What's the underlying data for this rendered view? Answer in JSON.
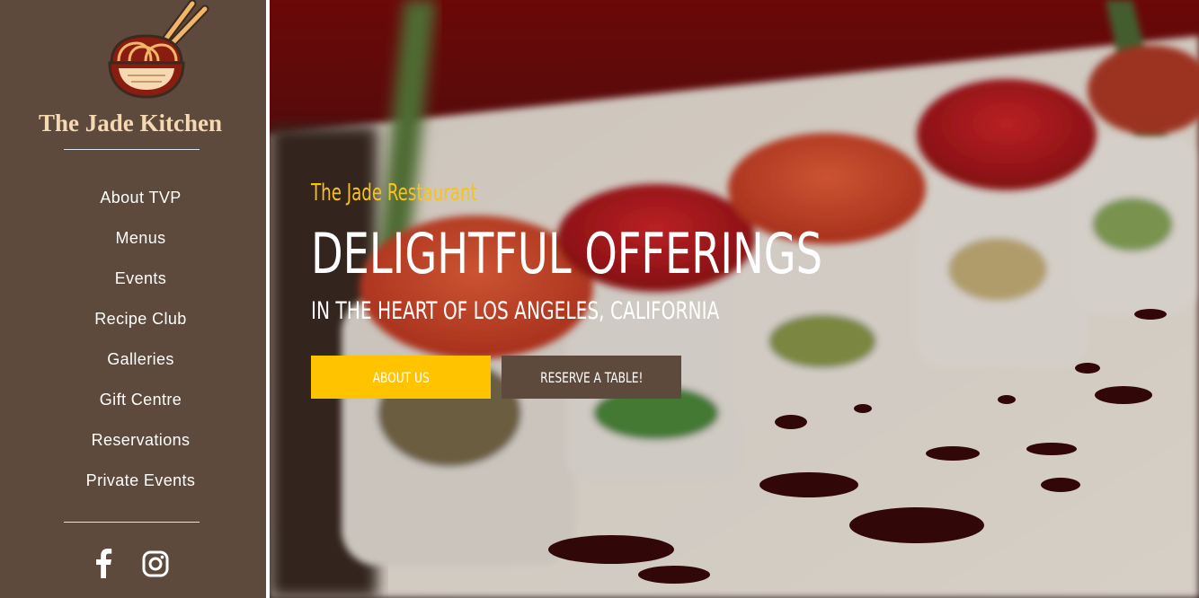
{
  "brand": {
    "name": "The Jade Kitchen",
    "logo_icon": "noodle-bowl-chopsticks-icon"
  },
  "nav": {
    "items": [
      {
        "label": "About TVP"
      },
      {
        "label": "Menus"
      },
      {
        "label": "Events"
      },
      {
        "label": "Recipe Club"
      },
      {
        "label": "Galleries"
      },
      {
        "label": "Gift Centre"
      },
      {
        "label": "Reservations"
      },
      {
        "label": "Private Events"
      }
    ]
  },
  "social": {
    "icons": [
      "facebook-icon",
      "instagram-icon"
    ]
  },
  "hero": {
    "eyebrow": "The Jade Restaurant",
    "headline": "DELIGHTFUL OFFERINGS",
    "subline": "IN THE HEART OF LOS ANGELES, CALIFORNIA",
    "primary_button": "ABOUT US",
    "secondary_button": "RESERVE A TABLE!"
  },
  "colors": {
    "sidebar_bg": "#5d4a3c",
    "brand_text": "#f6d9b2",
    "accent_yellow": "#ffc300",
    "eyebrow_yellow": "#f7c21a"
  }
}
